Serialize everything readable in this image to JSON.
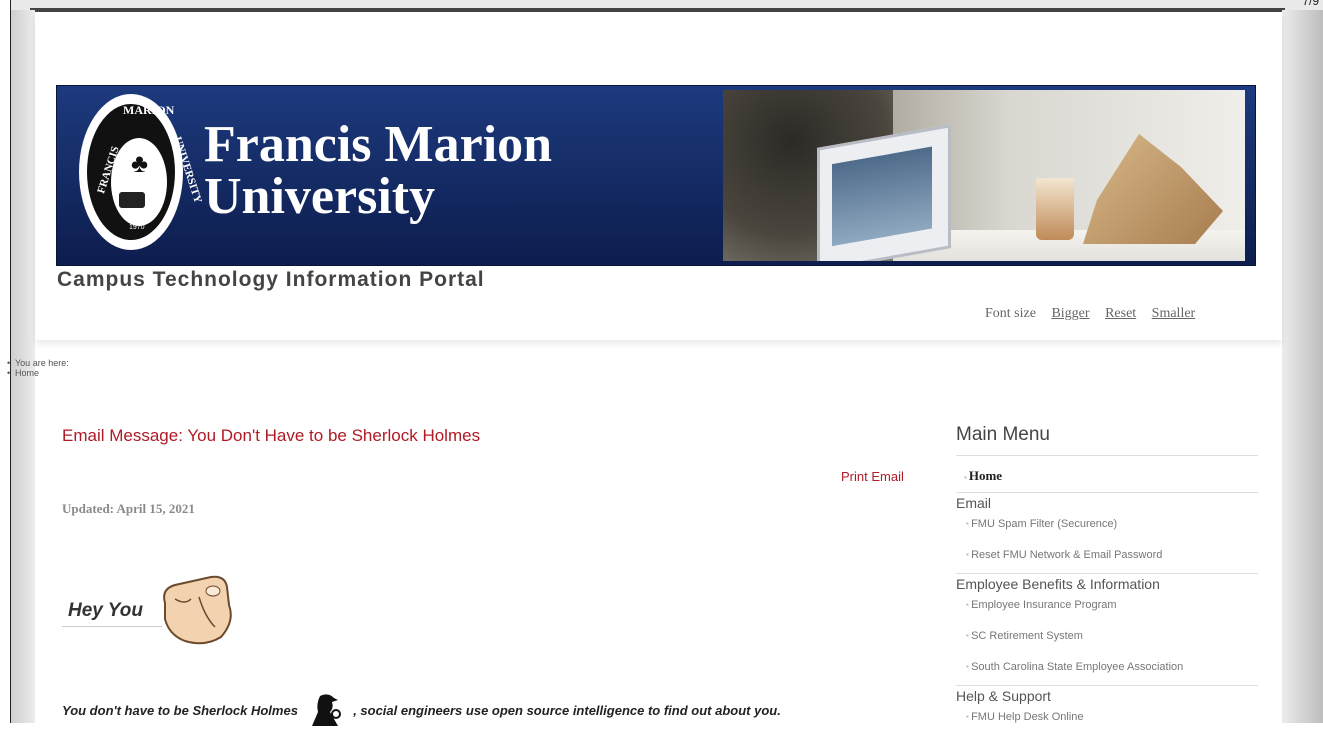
{
  "corner_text": "7/9",
  "banner": {
    "line1": "Francis Marion",
    "line2": "University",
    "seal_top": "MARION",
    "seal_left": "FRANCIS",
    "seal_right": "UNIVERSITY",
    "seal_year": "1970"
  },
  "portal_title": "Campus Technology Information Portal",
  "font_size": {
    "label": "Font size",
    "bigger": "Bigger",
    "reset": "Reset",
    "smaller": "Smaller"
  },
  "breadcrumb": [
    "You are here:",
    "Home"
  ],
  "article": {
    "title": "Email Message: You Don't Have to be Sherlock Holmes",
    "print_label": "Print Email",
    "updated": "Updated:  April 15, 2021",
    "hey_you": "Hey You",
    "sherlock_before": "You don't have to be Sherlock Holmes",
    "sherlock_after": ", social engineers use open source intelligence to find out about you."
  },
  "menu": {
    "title": "Main Menu",
    "home": "Home",
    "sections": [
      {
        "label": "Email",
        "items": [
          "FMU Spam Filter (Securence)",
          "Reset FMU Network & Email Password"
        ]
      },
      {
        "label": "Employee Benefits & Information",
        "items": [
          "Employee Insurance Program",
          "SC Retirement System",
          "South Carolina State Employee Association"
        ]
      },
      {
        "label": "Help & Support",
        "items": [
          "FMU Help Desk Online"
        ]
      }
    ]
  },
  "colors": {
    "accent": "#b01a24",
    "banner": "#1d3a7e"
  },
  "icons": [
    "pointing-hand-icon",
    "sherlock-holmes-icon"
  ]
}
